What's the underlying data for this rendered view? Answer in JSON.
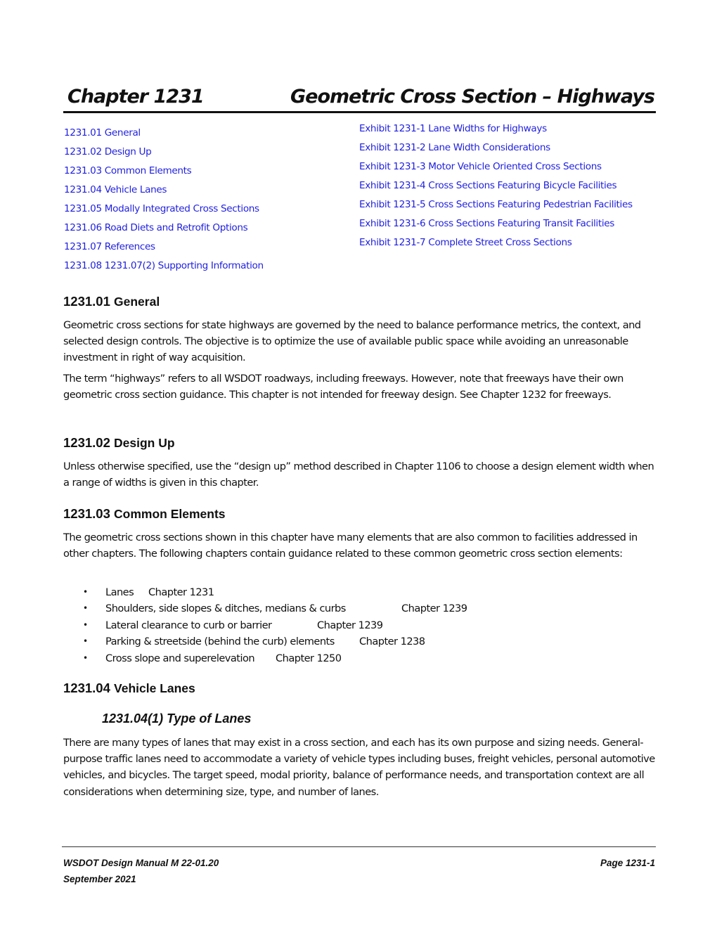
{
  "header": {
    "chapter": "Chapter 1231",
    "title": "Geometric Cross Section – Highways"
  },
  "toc": {
    "sections": [
      {
        "label": "1231.01 General"
      },
      {
        "label": "1231.02 Design Up"
      },
      {
        "label": "1231.03 Common Elements"
      },
      {
        "label": "1231.04 Vehicle Lanes"
      },
      {
        "label": "1231.05 Modally Integrated Cross Sections"
      },
      {
        "label": "1231.06 Road Diets and Retrofit Options"
      },
      {
        "label": "1231.07 References"
      },
      {
        "label": "1231.08 1231.07(2) Supporting Information"
      }
    ],
    "exhibits": [
      {
        "label": "Exhibit 1231-1 Lane Widths for Highways"
      },
      {
        "label": "Exhibit 1231-2 Lane Width Considerations"
      },
      {
        "label": "Exhibit 1231-3 Motor Vehicle Oriented Cross Sections"
      },
      {
        "label": "Exhibit 1231-4 Cross Sections Featuring Bicycle Facilities"
      },
      {
        "label": "Exhibit 1231-5 Cross Sections Featuring Pedestrian Facilities"
      },
      {
        "label": "Exhibit 1231-6 Cross Sections Featuring Transit Facilities"
      },
      {
        "label": "Exhibit 1231-7 Complete Street Cross Sections"
      }
    ]
  },
  "sections": {
    "general": {
      "number": "1231.01",
      "name": "General",
      "p1": "Geometric cross sections for state highways are governed by the need to balance performance metrics, the context, and selected design controls. The objective is to optimize the use of available public space while avoiding an unreasonable investment in right of way acquisition.",
      "p2": "The term “highways” refers to all WSDOT roadways, including freeways. However, note that freeways have their own geometric cross section guidance. This chapter is not intended for freeway design. See Chapter 1232 for freeways."
    },
    "design_up": {
      "number": "1231.02",
      "name": "Design Up",
      "p1": "Unless otherwise specified, use the “design up” method described in Chapter 1106 to choose a design element width when a range of widths is given in this chapter."
    },
    "common_elements": {
      "number": "1231.03",
      "name": "Common Elements",
      "p1": "The geometric cross sections shown in this chapter have many elements that are also common to facilities addressed in other chapters. The following chapters contain guidance related to these common geometric cross section elements:",
      "bullets": [
        {
          "item": "Lanes",
          "chapter": "Chapter 1231"
        },
        {
          "item": "Shoulders, side slopes & ditches, medians & curbs",
          "chapter": "Chapter 1239"
        },
        {
          "item": "Lateral clearance to curb or barrier",
          "chapter": "Chapter 1239"
        },
        {
          "item": "Parking & streetside (behind the curb) elements",
          "chapter": "Chapter 1238"
        },
        {
          "item": "Cross slope and superelevation",
          "chapter": "Chapter 1250"
        }
      ],
      "bullet_glyph": "•"
    },
    "vehicle_lanes": {
      "number": "1231.04",
      "name": "Vehicle Lanes",
      "sub_heading": "1231.04(1) Type of Lanes",
      "p1": "There are many types of lanes that may exist in a cross section, and each has its own purpose and sizing needs. General-purpose traffic lanes need to accommodate a variety of vehicle types including buses, freight vehicles, personal automotive vehicles, and bicycles. The target speed, modal priority, balance of performance needs, and transportation context are all considerations when determining size, type, and number of lanes."
    }
  },
  "footer": {
    "manual": "WSDOT Design Manual M 22-01.20",
    "page": "Page 1231-1",
    "date": "September 2021"
  },
  "colors": {
    "link": "#1f1fe0",
    "text": "#111111"
  }
}
